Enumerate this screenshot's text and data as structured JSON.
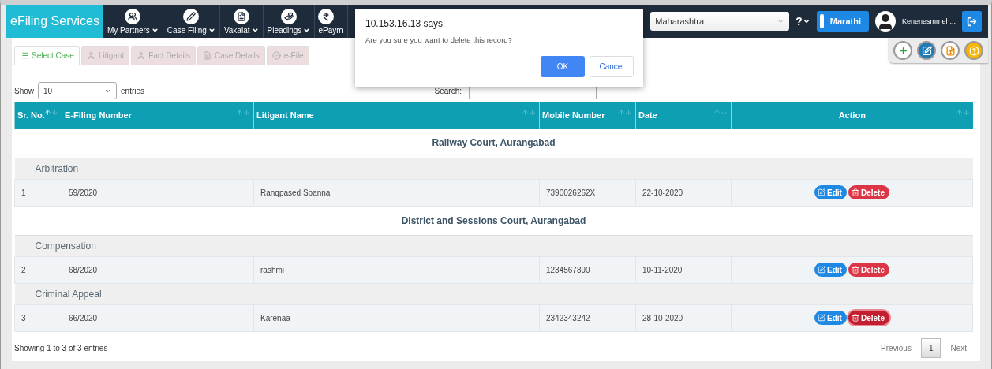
{
  "brand": "eFiling Services",
  "nav": [
    {
      "label": "My Partners"
    },
    {
      "label": "Case Filing"
    },
    {
      "label": "Vakalat"
    },
    {
      "label": "Pleadings"
    },
    {
      "label": "ePaym"
    }
  ],
  "state_select": "Maharashtra",
  "help": "?",
  "language": "Marathi",
  "user": "Kenenesmmeh...",
  "tabs": [
    {
      "label": "Select Case",
      "selected": true
    },
    {
      "label": "Litigant",
      "selected": false
    },
    {
      "label": "Fact Details",
      "selected": false
    },
    {
      "label": "Case Details",
      "selected": false
    },
    {
      "label": "e-File",
      "selected": false
    }
  ],
  "toolbar": [
    {
      "kind": "add"
    },
    {
      "kind": "edit"
    },
    {
      "kind": "pdf"
    },
    {
      "kind": "help"
    }
  ],
  "length": {
    "show": "Show",
    "value": "10",
    "entries": "entries"
  },
  "search": {
    "label": "Search:"
  },
  "table": {
    "columns": [
      {
        "label": "Sr. No.",
        "sorted": true
      },
      {
        "label": "E-Filing Number",
        "sorted": false
      },
      {
        "label": "Litigant Name",
        "sorted": false
      },
      {
        "label": "Mobile Number",
        "sorted": false
      },
      {
        "label": "Date",
        "sorted": false
      },
      {
        "label": "Action",
        "sorted": false
      }
    ],
    "groups": [
      {
        "court": "Railway Court, Aurangabad",
        "categories": [
          {
            "name": "Arbitration",
            "rows": [
              {
                "sr": "1",
                "number": "59/2020",
                "litigant": "Ranqpased Sbanna",
                "mobile": "7390026262X",
                "date": "22-10-2020",
                "edit": "Edit",
                "delete": "Delete",
                "focused": false
              }
            ]
          }
        ]
      },
      {
        "court": "District and Sessions Court, Aurangabad",
        "categories": [
          {
            "name": "Compensation",
            "rows": [
              {
                "sr": "2",
                "number": "68/2020",
                "litigant": "rashmi",
                "mobile": "1234567890",
                "date": "10-11-2020",
                "edit": "Edit",
                "delete": "Delete",
                "focused": false
              }
            ]
          },
          {
            "name": "Criminal Appeal",
            "rows": [
              {
                "sr": "3",
                "number": "66/2020",
                "litigant": "Karenaa",
                "mobile": "2342343242",
                "date": "28-10-2020",
                "edit": "Edit",
                "delete": "Delete",
                "focused": true
              }
            ]
          }
        ]
      }
    ]
  },
  "info": "Showing 1 to 3 of 3 entries",
  "pagination": {
    "previous": "Previous",
    "pages": [
      {
        "label": "1",
        "selected": true
      }
    ],
    "next": "Next"
  },
  "dialog": {
    "title": "10.153.16.13 says",
    "message": "Are you sure you want to delete this record?",
    "ok": "OK",
    "cancel": "Cancel"
  }
}
